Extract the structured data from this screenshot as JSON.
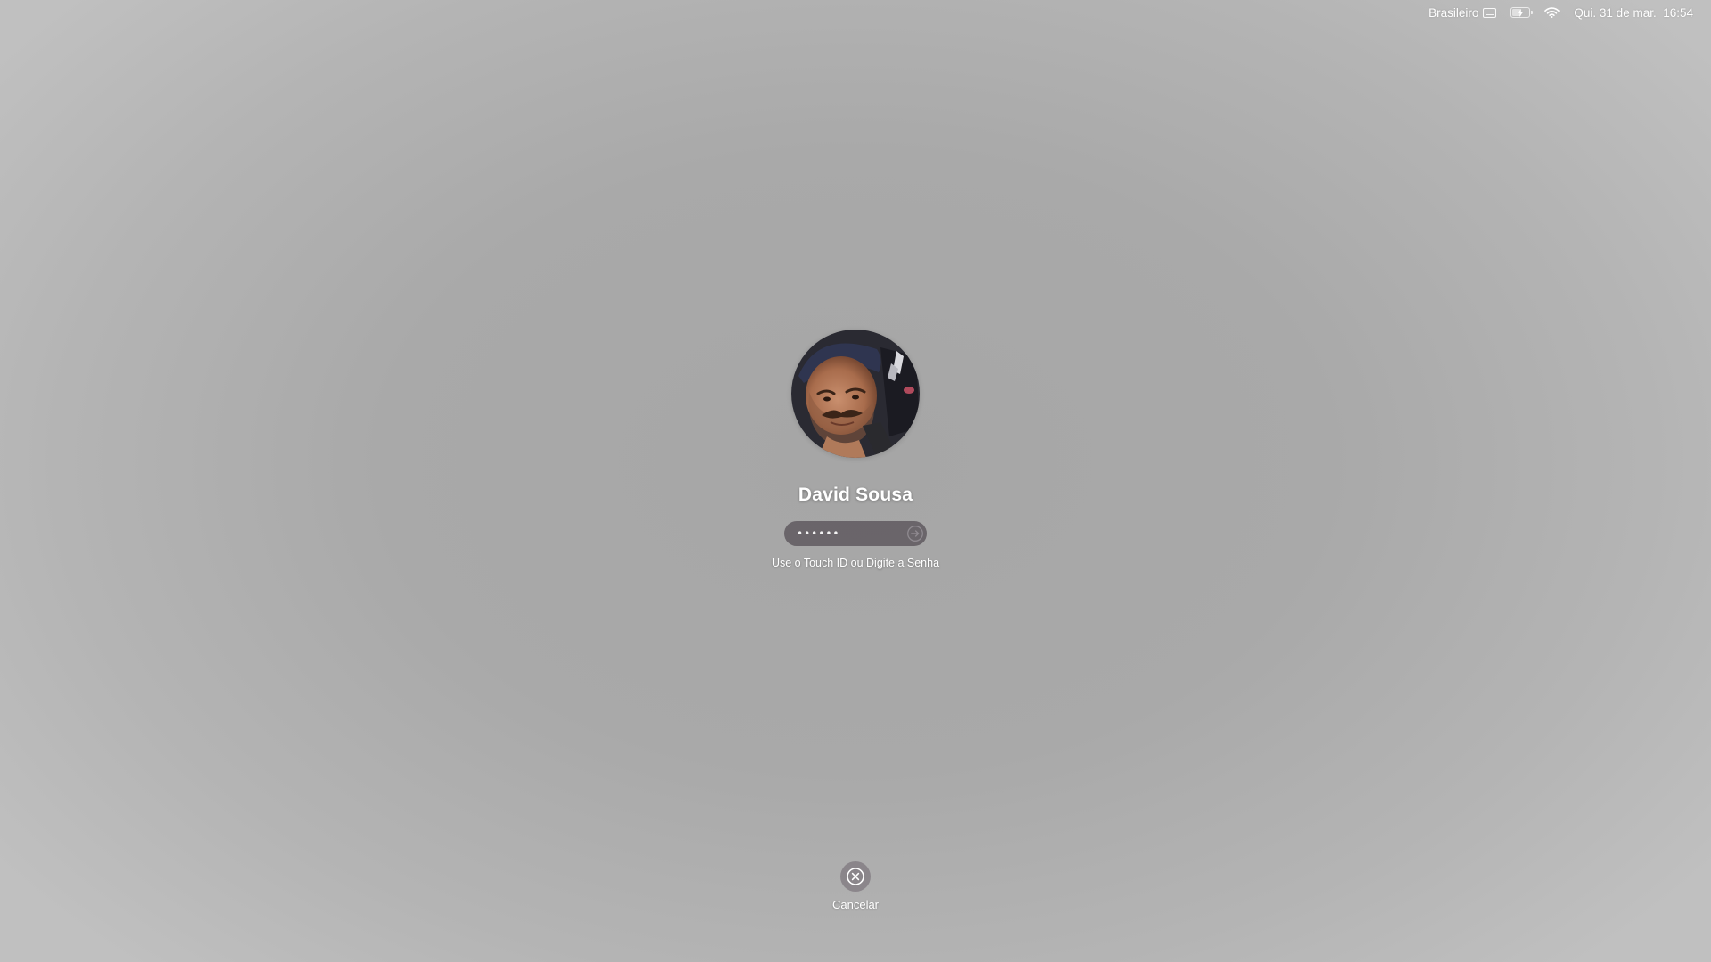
{
  "menubar": {
    "input_source": "Brasileiro",
    "datetime": "Qui. 31 de mar.  16:54",
    "battery_level": 0.6,
    "icons": [
      "keyboard-icon",
      "battery-charging-icon",
      "wifi-icon"
    ]
  },
  "login": {
    "username": "David Sousa",
    "password_masked": "••••••",
    "hint": "Use o Touch ID ou Digite a Senha",
    "avatar_icon": "user-photo",
    "submit_icon": "arrow-right-circle-icon"
  },
  "cancel": {
    "label": "Cancelar",
    "icon": "x-circle-icon"
  },
  "colors": {
    "background": "#a9a9a9",
    "field": "#58525b"
  }
}
